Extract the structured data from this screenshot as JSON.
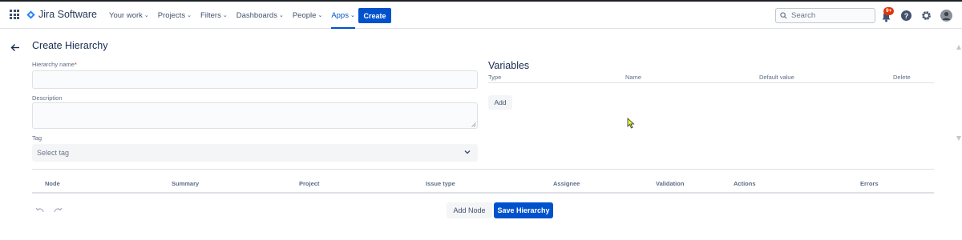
{
  "header": {
    "product_name": "Jira Software",
    "nav_items": [
      {
        "label": "Your work"
      },
      {
        "label": "Projects"
      },
      {
        "label": "Filters"
      },
      {
        "label": "Dashboards"
      },
      {
        "label": "People"
      },
      {
        "label": "Apps"
      }
    ],
    "active_nav": "Apps",
    "create_label": "Create",
    "search_placeholder": "Search",
    "notification_count": "9+"
  },
  "page": {
    "title": "Create Hierarchy",
    "hierarchy_name_label": "Hierarchy name",
    "required_marker": "*",
    "description_label": "Description",
    "tag_label": "Tag",
    "tag_placeholder": "Select tag"
  },
  "variables": {
    "title": "Variables",
    "columns": [
      "Type",
      "Name",
      "Default value",
      "Delete"
    ],
    "add_label": "Add"
  },
  "nodes_table": {
    "columns": [
      "Node",
      "Summary",
      "Project",
      "Issue type",
      "Assignee",
      "Validation",
      "Actions",
      "Errors"
    ]
  },
  "footer": {
    "add_node_label": "Add Node",
    "save_label": "Save Hierarchy"
  },
  "colors": {
    "brand": "#0052cc",
    "badge": "#de350b",
    "text": "#172b4d",
    "muted": "#5e6c84"
  },
  "icons": [
    "app-switcher-icon",
    "jira-logo-icon",
    "search-icon",
    "bell-icon",
    "help-icon",
    "gear-icon",
    "avatar",
    "back-arrow-icon",
    "chevron-down-icon",
    "undo-icon",
    "redo-icon",
    "cursor-icon"
  ]
}
